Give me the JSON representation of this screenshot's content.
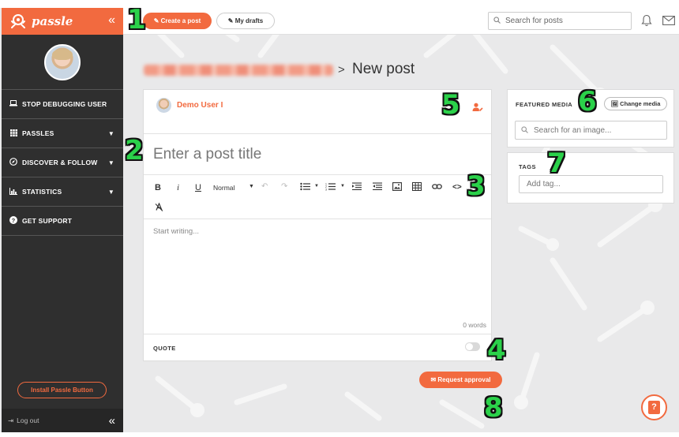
{
  "brand": {
    "name": "passle",
    "accent": "#f26a3f",
    "sidebar_bg": "#2f2f2f",
    "callout_color": "#2bd14a"
  },
  "sidebar": {
    "collapse_icon": "double-chevron-left-icon",
    "items": [
      {
        "label": "STOP DEBUGGING USER",
        "icon": "laptop-icon"
      },
      {
        "label": "PASSLES",
        "icon": "grid-icon",
        "has_dropdown": true
      },
      {
        "label": "DISCOVER & FOLLOW",
        "icon": "compass-icon",
        "has_dropdown": true
      },
      {
        "label": "STATISTICS",
        "icon": "bar-chart-icon",
        "has_dropdown": true
      },
      {
        "label": "GET SUPPORT",
        "icon": "question-circle-icon"
      }
    ],
    "install_button": "Install Passle Button",
    "logout": "Log out"
  },
  "topbar": {
    "create_post": "Create a post",
    "my_drafts": "My drafts",
    "search_placeholder": "Search for posts"
  },
  "breadcrumb": {
    "separator": ">",
    "current": "New post"
  },
  "editor": {
    "author_name": "Demo User I",
    "title_placeholder": "Enter a post title",
    "toolbar": {
      "bold": "B",
      "italic": "i",
      "underline": "U",
      "format_select": "Normal",
      "code": "<>"
    },
    "body_placeholder": "Start writing...",
    "word_count": "0 words",
    "quote_label": "QUOTE",
    "quote_enabled": false
  },
  "request_approval": "Request approval",
  "featured_media": {
    "title": "FEATURED MEDIA",
    "change_button": "Change media",
    "search_placeholder": "Search for an image..."
  },
  "tags": {
    "title": "TAGS",
    "placeholder": "Add tag..."
  },
  "callouts": [
    "1",
    "2",
    "3",
    "4",
    "5",
    "6",
    "7",
    "8"
  ],
  "help_button": "?"
}
